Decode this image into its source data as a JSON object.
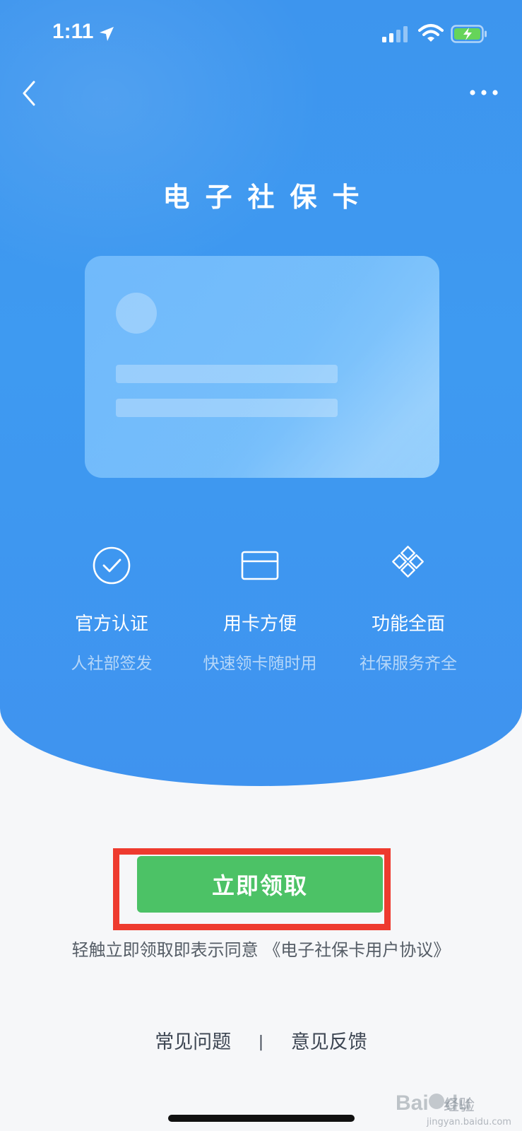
{
  "status_bar": {
    "time": "1:11"
  },
  "nav": {
    "back_icon": "chevron-left-icon",
    "more_icon": "more-dots-icon"
  },
  "title": "电子社保卡",
  "features": [
    {
      "icon": "check-circle-icon",
      "title": "官方认证",
      "subtitle": "人社部签发"
    },
    {
      "icon": "card-icon",
      "title": "用卡方便",
      "subtitle": "快速领卡随时用"
    },
    {
      "icon": "grid-diamond-icon",
      "title": "功能全面",
      "subtitle": "社保服务齐全"
    }
  ],
  "claim_button": {
    "label": "立即领取"
  },
  "agreement": {
    "prefix": "轻触立即领取即表示同意",
    "link": "《电子社保卡用户协议》"
  },
  "footer": {
    "faq": "常见问题",
    "separator": "|",
    "feedback": "意见反馈"
  },
  "watermark": {
    "text": "经验",
    "url": "jingyan.baidu.com"
  },
  "colors": {
    "hero_blue": "#3e97f0",
    "button_green": "#4cc266",
    "highlight_red": "#ee3b2f",
    "page_bg": "#f6f7f9"
  }
}
